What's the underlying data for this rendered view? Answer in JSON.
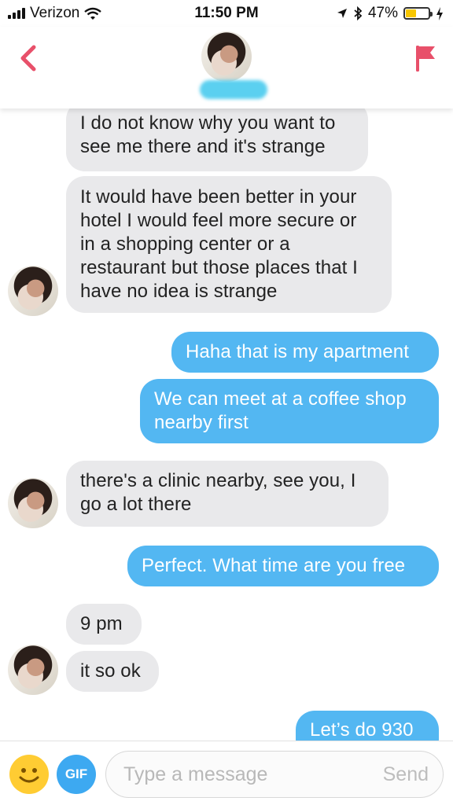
{
  "status_bar": {
    "carrier": "Verizon",
    "time": "11:50 PM",
    "battery": "47%",
    "battery_level": 0.47
  },
  "header": {
    "back_icon": "chevron-left-icon",
    "flag_icon": "flag-icon",
    "accent_color": "#e8506a"
  },
  "messages": [
    {
      "direction": "incoming",
      "lines": [
        "I do not know why you want to",
        "see me there and it's strange"
      ]
    },
    {
      "direction": "incoming",
      "lines": [
        "It would have been better in your",
        "hotel I would feel more secure or",
        "in a shopping center or a",
        "restaurant but those places that I",
        "have no idea is strange"
      ]
    },
    {
      "direction": "outgoing",
      "lines": [
        "Haha that is my apartment"
      ]
    },
    {
      "direction": "outgoing",
      "lines": [
        "We can meet at a coffee shop",
        "nearby first"
      ]
    },
    {
      "direction": "incoming",
      "lines": [
        "there's a clinic nearby, see you, I",
        "go a lot there"
      ]
    },
    {
      "direction": "outgoing",
      "lines": [
        "Perfect. What time are you free"
      ]
    },
    {
      "direction": "incoming",
      "lines": [
        "9 pm"
      ]
    },
    {
      "direction": "incoming",
      "lines": [
        "it so ok"
      ]
    },
    {
      "direction": "outgoing",
      "lines": [
        "Let’s do 930"
      ]
    }
  ],
  "input_bar": {
    "gif_label": "GIF",
    "placeholder": "Type a message",
    "send_label": "Send"
  },
  "colors": {
    "outgoing_bubble": "#53b7f2",
    "incoming_bubble": "#e9e9eb",
    "gif_button": "#3da9f1",
    "emoji": "#ffcc33"
  }
}
